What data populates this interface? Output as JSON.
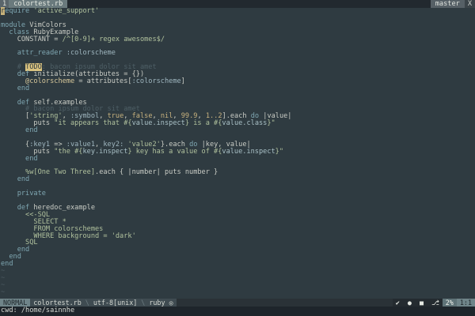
{
  "tabline": {
    "tab_number": "1",
    "tab_label": "colortest.rb",
    "branch_label": "master",
    "close_label": "X"
  },
  "editor": {
    "lines": [
      "require 'active_support'",
      "",
      "module VimColors",
      "  class RubyExample",
      "    CONSTANT = /^[0-9]+ regex awesomes$/",
      "",
      "    attr_reader :colorscheme",
      "",
      "    # TODO: bacon ipsum dolor sit amet",
      "    def initialize(attributes = {})",
      "      @colorscheme = attributes[:colorscheme]",
      "    end",
      "",
      "    def self.examples",
      "      # bacon ipsum dolor sit amet",
      "      ['string', :symbol, true, false, nil, 99.9, 1..2].each do |value|",
      "        puts \"it appears that #{value.inspect} is a #{value.class}\"",
      "      end",
      "",
      "      {:key1 => :value1, key2: 'value2'}.each do |key, value|",
      "        puts \"the #{key.inspect} key has a value of #{value.inspect}\"",
      "      end",
      "",
      "      %w[One Two Three].each { |number| puts number }",
      "    end",
      "",
      "    private",
      "",
      "    def heredoc_example",
      "      <<-SQL",
      "        SELECT *",
      "        FROM colorschemes",
      "        WHERE background = 'dark'",
      "      SQL",
      "    end",
      "  end",
      "end"
    ],
    "empty_marker": "~",
    "empty_line_count": 4
  },
  "statusline": {
    "mode": "NORMAL",
    "filename": "colortest.rb",
    "encoding": "utf-8[unix]",
    "filetype": "ruby",
    "percent": "2%",
    "position": "1:1"
  },
  "cmdline": {
    "text": "cwd: /home/sainnhe"
  }
}
